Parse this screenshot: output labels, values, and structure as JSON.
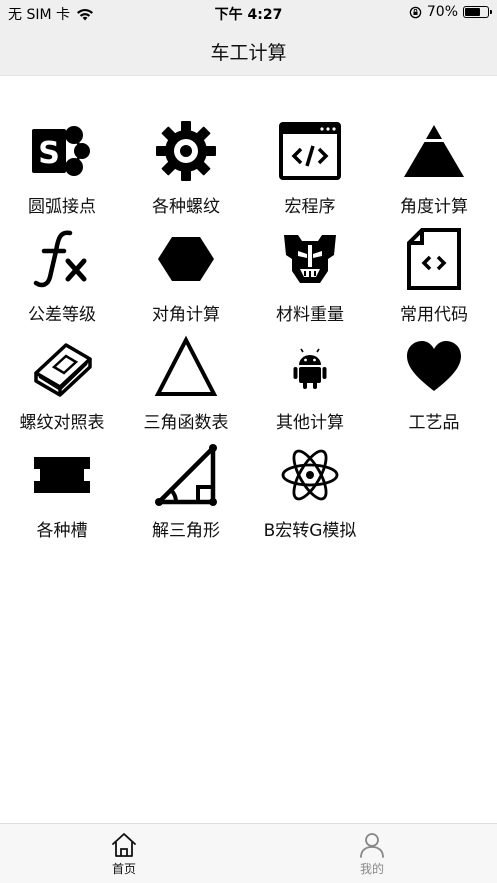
{
  "status_bar": {
    "carrier": "无 SIM 卡",
    "time": "下午 4:27",
    "battery_percent": "70%",
    "battery_level": 0.7
  },
  "nav": {
    "title": "车工计算"
  },
  "grid_items": [
    {
      "label": "圆弧接点",
      "icon": "sharepoint-icon"
    },
    {
      "label": "各种螺纹",
      "icon": "gear-icon"
    },
    {
      "label": "宏程序",
      "icon": "code-window-icon"
    },
    {
      "label": "角度计算",
      "icon": "pyramid-icon"
    },
    {
      "label": "公差等级",
      "icon": "function-icon"
    },
    {
      "label": "对角计算",
      "icon": "hexagon-icon"
    },
    {
      "label": "材料重量",
      "icon": "transformer-icon"
    },
    {
      "label": "常用代码",
      "icon": "code-file-icon"
    },
    {
      "label": "螺纹对照表",
      "icon": "book-icon"
    },
    {
      "label": "三角函数表",
      "icon": "triangle-icon"
    },
    {
      "label": "其他计算",
      "icon": "android-icon"
    },
    {
      "label": "工艺品",
      "icon": "heart-icon"
    },
    {
      "label": "各种槽",
      "icon": "slot-icon"
    },
    {
      "label": "解三角形",
      "icon": "right-triangle-icon"
    },
    {
      "label": "B宏转G模拟",
      "icon": "atom-icon"
    }
  ],
  "tab_bar": {
    "home_label": "首页",
    "mine_label": "我的",
    "active": "首页"
  }
}
